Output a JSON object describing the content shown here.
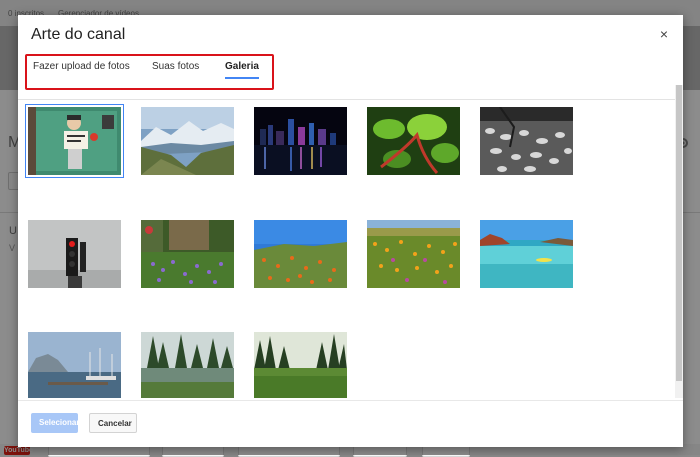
{
  "background": {
    "topbar_left": "0 inscritos",
    "topbar_mid": "Gerenciador de vídeos",
    "letter_m": "M",
    "letter_u": "U",
    "letter_v": "V",
    "youtube_logo": "YouTube"
  },
  "dialog": {
    "title": "Arte do canal",
    "close_label": "×",
    "tabs": [
      {
        "label": "Fazer upload de fotos",
        "active": false
      },
      {
        "label": "Suas fotos",
        "active": false
      },
      {
        "label": "Galeria",
        "active": true
      }
    ],
    "gallery": [
      {
        "subject": "girl with sign on green wall",
        "selected": true
      },
      {
        "subject": "mountain valley with clouds",
        "selected": false
      },
      {
        "subject": "city skyline at night over harbor",
        "selected": false
      },
      {
        "subject": "green leaves with red stem",
        "selected": false
      },
      {
        "subject": "black and white leaves on ground",
        "selected": false
      },
      {
        "subject": "red traffic light in fog",
        "selected": false
      },
      {
        "subject": "purple flowers in forest",
        "selected": false
      },
      {
        "subject": "orange poppy field and blue sky",
        "selected": false
      },
      {
        "subject": "wildflower meadow",
        "selected": false
      },
      {
        "subject": "clear sea water and rocky coast",
        "selected": false
      },
      {
        "subject": "harbor with boats and rock",
        "selected": false
      },
      {
        "subject": "pine forest and pond",
        "selected": false
      },
      {
        "subject": "forest clearing with meadow",
        "selected": false
      }
    ],
    "buttons": {
      "select": "Selecionar",
      "cancel": "Cancelar"
    }
  },
  "colors": {
    "accent": "#4285f4",
    "highlight_box": "#d9131a",
    "select_button_disabled": "#a8c7f7"
  }
}
